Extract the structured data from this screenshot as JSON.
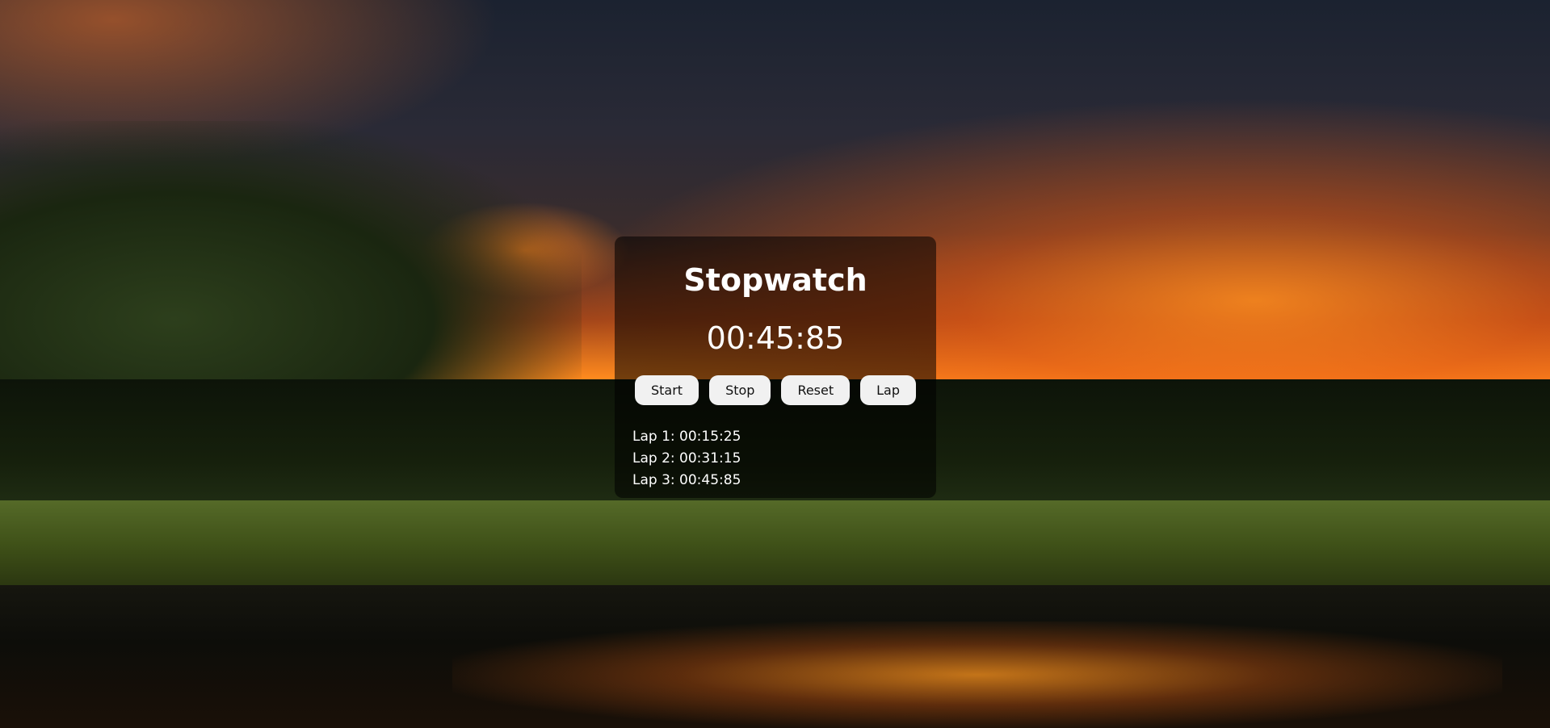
{
  "app": {
    "title": "Stopwatch",
    "time": "00:45:85"
  },
  "controls": {
    "start_label": "Start",
    "stop_label": "Stop",
    "reset_label": "Reset",
    "lap_label": "Lap"
  },
  "laps": [
    "Lap 1: 00:15:25",
    "Lap 2: 00:31:15",
    "Lap 3: 00:45:85"
  ],
  "colors": {
    "panel_background": "rgba(0,0,0,0.55)",
    "text": "#ffffff",
    "button_background": "#f1f1f1",
    "button_text": "#111111"
  }
}
